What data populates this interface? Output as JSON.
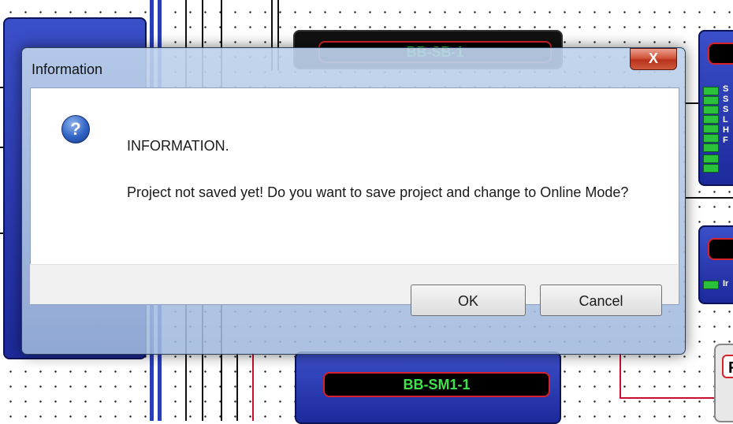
{
  "dialog": {
    "title": "Information",
    "close_glyph": "X",
    "icon": "question-icon",
    "icon_glyph": "?",
    "heading": "INFORMATION.",
    "message": "Project not saved yet! Do you want to save project and change to Online Mode?",
    "ok_label": "OK",
    "cancel_label": "Cancel"
  },
  "background": {
    "top_block_label": "BB-SB-1",
    "bottom_block_label": "BB-SM1-1",
    "right_block_partial": "F",
    "right_ports_top": [
      "S",
      "S",
      "S",
      "L",
      "H",
      "F"
    ],
    "right_ports_mid": [
      "Ir"
    ]
  },
  "colors": {
    "block_blue": "#2a3db8",
    "wire_red": "#c8102e",
    "port_green": "#29c23a",
    "close_red": "#c8432a"
  }
}
